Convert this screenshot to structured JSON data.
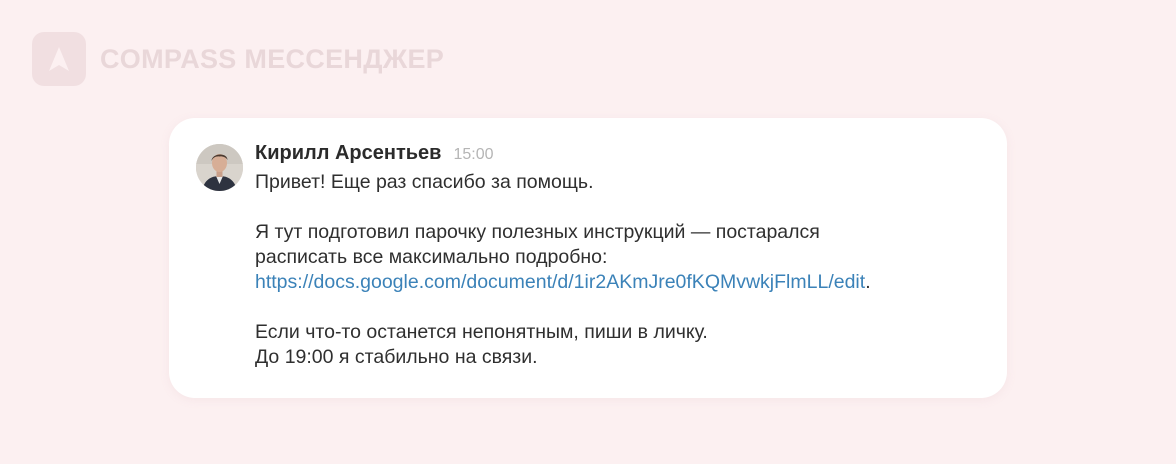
{
  "brand": {
    "name": "COMPASS МЕССЕНДЖЕР",
    "logo_icon": "compass-arrow-icon"
  },
  "message": {
    "author": "Кирилл Арсентьев",
    "time": "15:00",
    "avatar_icon": "user-avatar",
    "line1": "Привет! Еще раз спасибо за помощь.",
    "line2": "Я тут подготовил парочку полезных инструкций — постарался",
    "line3": "расписать все максимально подробно:",
    "link": "https://docs.google.com/document/d/1ir2AKmJre0fKQMvwkjFlmLL/edit",
    "link_suffix": ".",
    "line4": "Если что-то останется непонятным, пиши в личку.",
    "line5": "До 19:00 я стабильно на связи."
  },
  "colors": {
    "background": "#fcf0f1",
    "card": "#ffffff",
    "link": "#3b82b8",
    "brand_faded": "#e9d7d9"
  }
}
